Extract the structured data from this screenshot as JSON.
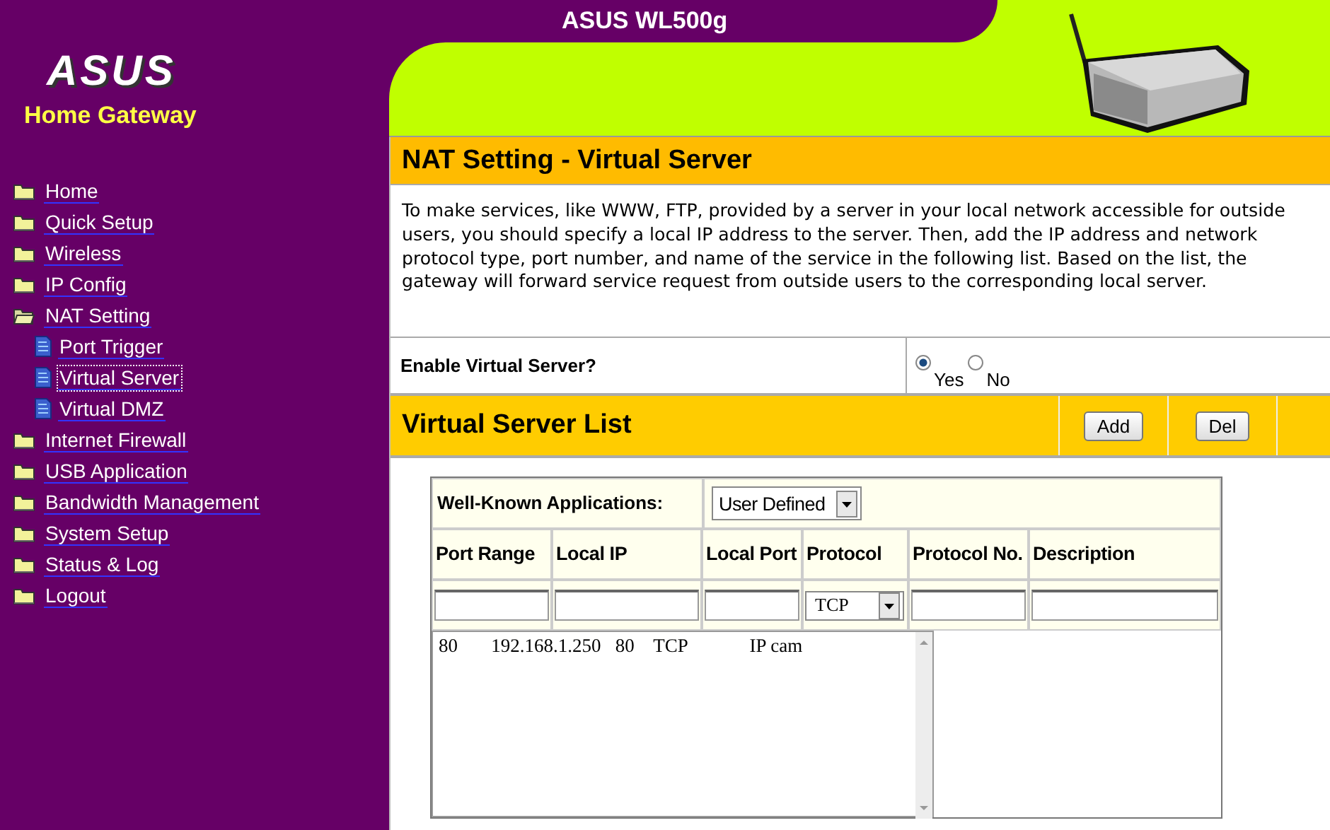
{
  "header": {
    "title": "ASUS WL500g"
  },
  "sidebar": {
    "logo": "ASUS",
    "subtitle": "Home Gateway",
    "items": [
      {
        "label": "Home",
        "selected": false,
        "expanded": false
      },
      {
        "label": "Quick Setup",
        "selected": false,
        "expanded": false
      },
      {
        "label": "Wireless",
        "selected": false,
        "expanded": false
      },
      {
        "label": "IP Config",
        "selected": false,
        "expanded": false
      },
      {
        "label": "NAT Setting",
        "selected": false,
        "expanded": true,
        "children": [
          {
            "label": "Port Trigger",
            "selected": false
          },
          {
            "label": "Virtual Server",
            "selected": true
          },
          {
            "label": "Virtual DMZ",
            "selected": false
          }
        ]
      },
      {
        "label": "Internet Firewall",
        "selected": false,
        "expanded": false
      },
      {
        "label": "USB Application",
        "selected": false,
        "expanded": false
      },
      {
        "label": "Bandwidth Management",
        "selected": false,
        "expanded": false
      },
      {
        "label": "System Setup",
        "selected": false,
        "expanded": false
      },
      {
        "label": "Status & Log",
        "selected": false,
        "expanded": false
      },
      {
        "label": "Logout",
        "selected": false,
        "expanded": false
      }
    ]
  },
  "page": {
    "title": "NAT Setting - Virtual Server",
    "description": "To make services, like WWW, FTP, provided by a server in your local network accessible for outside users, you should specify a local IP address to the server. Then, add the IP address and network protocol type, port number, and name of the service in the following list. Based on the list, the gateway will forward service request from outside users to the corresponding local server.",
    "enable": {
      "label": "Enable Virtual Server?",
      "options": [
        {
          "label": "Yes",
          "selected": true
        },
        {
          "label": "No",
          "selected": false
        }
      ]
    },
    "list": {
      "title": "Virtual Server List",
      "buttons": [
        "Add",
        "Del"
      ],
      "well_known": {
        "label": "Well-Known Applications:",
        "value": "User Defined"
      },
      "columns": [
        "Port Range",
        "Local IP",
        "Local Port",
        "Protocol",
        "Protocol No.",
        "Description"
      ],
      "input_row": [
        {
          "kind": "text"
        },
        {
          "kind": "text"
        },
        {
          "kind": "text"
        },
        {
          "kind": "select",
          "value": "TCP"
        },
        {
          "kind": "text"
        },
        {
          "kind": "text"
        }
      ],
      "entries": [
        "80       192.168.1.250   80    TCP             IP cam"
      ]
    }
  }
}
